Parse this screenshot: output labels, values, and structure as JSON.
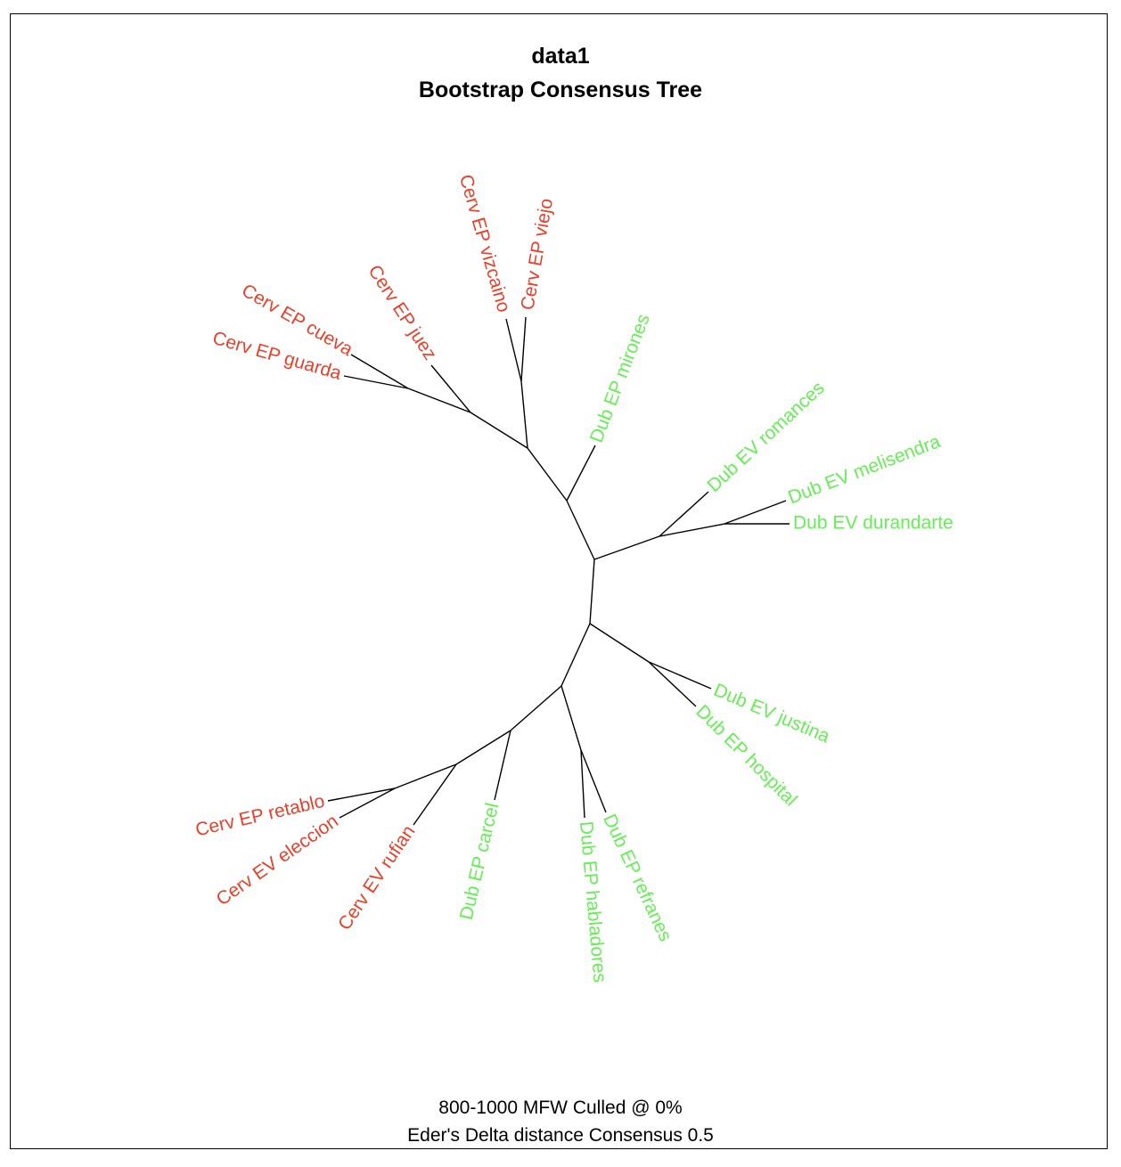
{
  "title_line1": "data1",
  "title_line2": "Bootstrap Consensus Tree",
  "footer_line1": "800-1000 MFW  Culled @ 0%",
  "footer_line2": "Eder's Delta distance Consensus 0.5",
  "colors": {
    "cervantes": "#e8402a",
    "dubious": "#66ee55",
    "branch": "#000000"
  },
  "leaves": [
    {
      "label": "Cerv EP viejo",
      "group": "cervantes"
    },
    {
      "label": "Cerv EP vizcaino",
      "group": "cervantes"
    },
    {
      "label": "Cerv EP juez",
      "group": "cervantes"
    },
    {
      "label": "Cerv EP cueva",
      "group": "cervantes"
    },
    {
      "label": "Cerv EP guarda",
      "group": "cervantes"
    },
    {
      "label": "Dub EP mirones",
      "group": "dubious"
    },
    {
      "label": "Dub EV romances",
      "group": "dubious"
    },
    {
      "label": "Dub EV melisendra",
      "group": "dubious"
    },
    {
      "label": "Dub EV durandarte",
      "group": "dubious"
    },
    {
      "label": "Dub EV justina",
      "group": "dubious"
    },
    {
      "label": "Dub EP hospital",
      "group": "dubious"
    },
    {
      "label": "Dub EP refranes",
      "group": "dubious"
    },
    {
      "label": "Dub EP habladores",
      "group": "dubious"
    },
    {
      "label": "Dub EP carcel",
      "group": "dubious"
    },
    {
      "label": "Cerv EV rufian",
      "group": "cervantes"
    },
    {
      "label": "Cerv EV eleccion",
      "group": "cervantes"
    },
    {
      "label": "Cerv EP retablo",
      "group": "cervantes"
    }
  ]
}
